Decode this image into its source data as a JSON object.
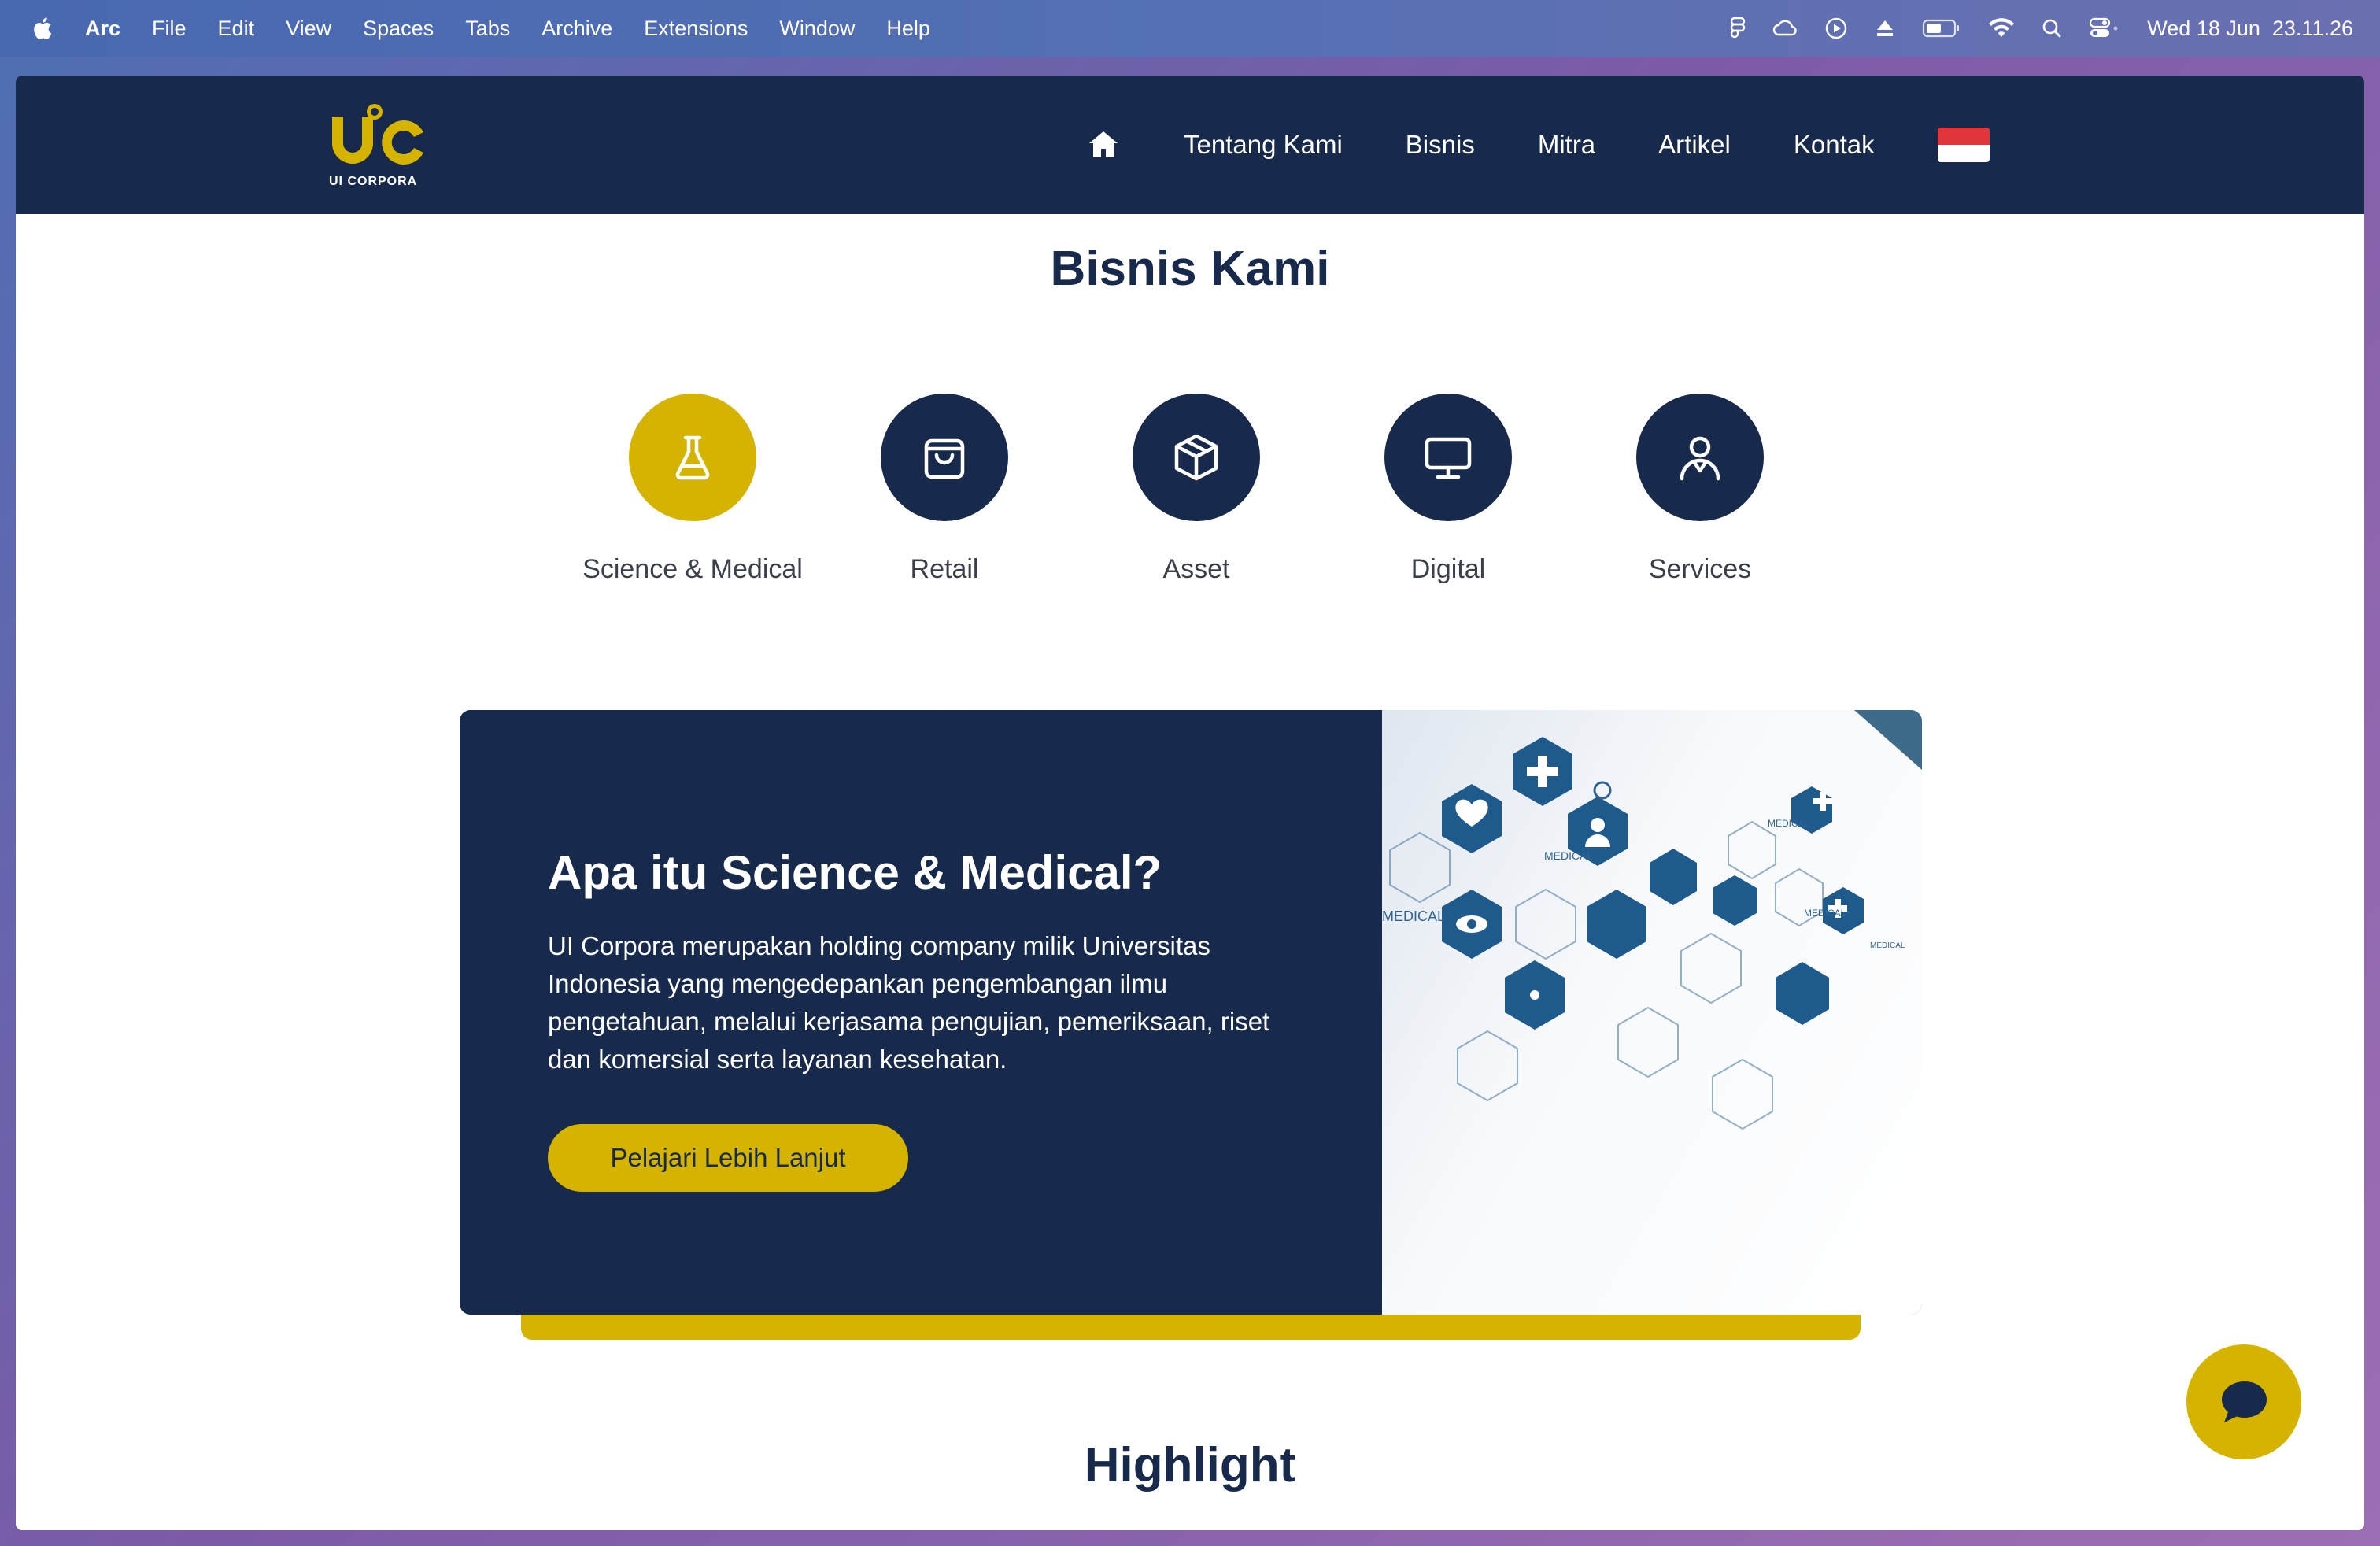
{
  "menubar": {
    "app": "Arc",
    "items": [
      "File",
      "Edit",
      "View",
      "Spaces",
      "Tabs",
      "Archive",
      "Extensions",
      "Window",
      "Help"
    ],
    "clock": "Wed 18 Jun  23.11.26"
  },
  "site": {
    "logo_text": "UI CORPORA",
    "nav": [
      "Tentang Kami",
      "Bisnis",
      "Mitra",
      "Artikel",
      "Kontak"
    ]
  },
  "business": {
    "title": "Bisnis Kami",
    "categories": [
      {
        "label": "Science & Medical",
        "icon": "flask-icon",
        "active": true
      },
      {
        "label": "Retail",
        "icon": "shopping-bag-icon",
        "active": false
      },
      {
        "label": "Asset",
        "icon": "box-icon",
        "active": false
      },
      {
        "label": "Digital",
        "icon": "monitor-icon",
        "active": false
      },
      {
        "label": "Services",
        "icon": "person-icon",
        "active": false
      }
    ]
  },
  "feature": {
    "heading": "Apa itu Science & Medical?",
    "body": "UI Corpora merupakan holding company milik Universitas Indonesia yang mengedepankan pengembangan ilmu pengetahuan, melalui kerjasama pengujian, pemeriksaan, riset dan komersial serta layanan kesehatan.",
    "cta": "Pelajari Lebih Lanjut",
    "image_labels": [
      "MEDICAL",
      "MEDICAL",
      "MEDICAL",
      "MEDICAL",
      "MEDICAL"
    ]
  },
  "highlight": {
    "title": "Highlight"
  },
  "colors": {
    "navy": "#182a4b",
    "gold": "#d4b400",
    "flag_red": "#e0353b"
  }
}
